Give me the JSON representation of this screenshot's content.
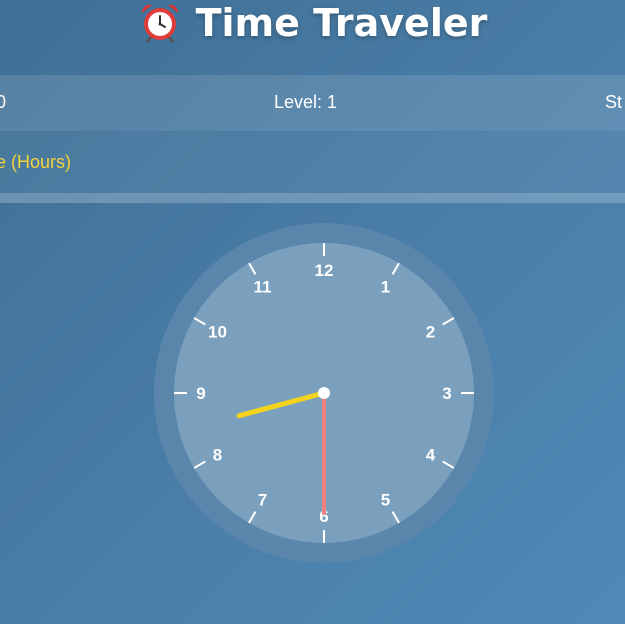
{
  "header": {
    "title": "Time Traveler",
    "icon": "alarm-clock-icon"
  },
  "stats": {
    "score_text": "0",
    "level_text": "Level: 1",
    "streak_text": "St"
  },
  "mode": {
    "text": "ne (Hours)",
    "color": "#f5d33a"
  },
  "progress": {
    "fraction": 0
  },
  "clock": {
    "numbers": [
      "12",
      "1",
      "2",
      "3",
      "4",
      "5",
      "6",
      "7",
      "8",
      "9",
      "10",
      "11"
    ],
    "time": {
      "hour": 8,
      "minute": 30
    },
    "colors": {
      "face": "#7aa0bd",
      "bezel": "#5a86ab",
      "hour_hand": "#f5d31c",
      "minute_hand": "#f08080",
      "ticks": "#ffffff"
    }
  }
}
